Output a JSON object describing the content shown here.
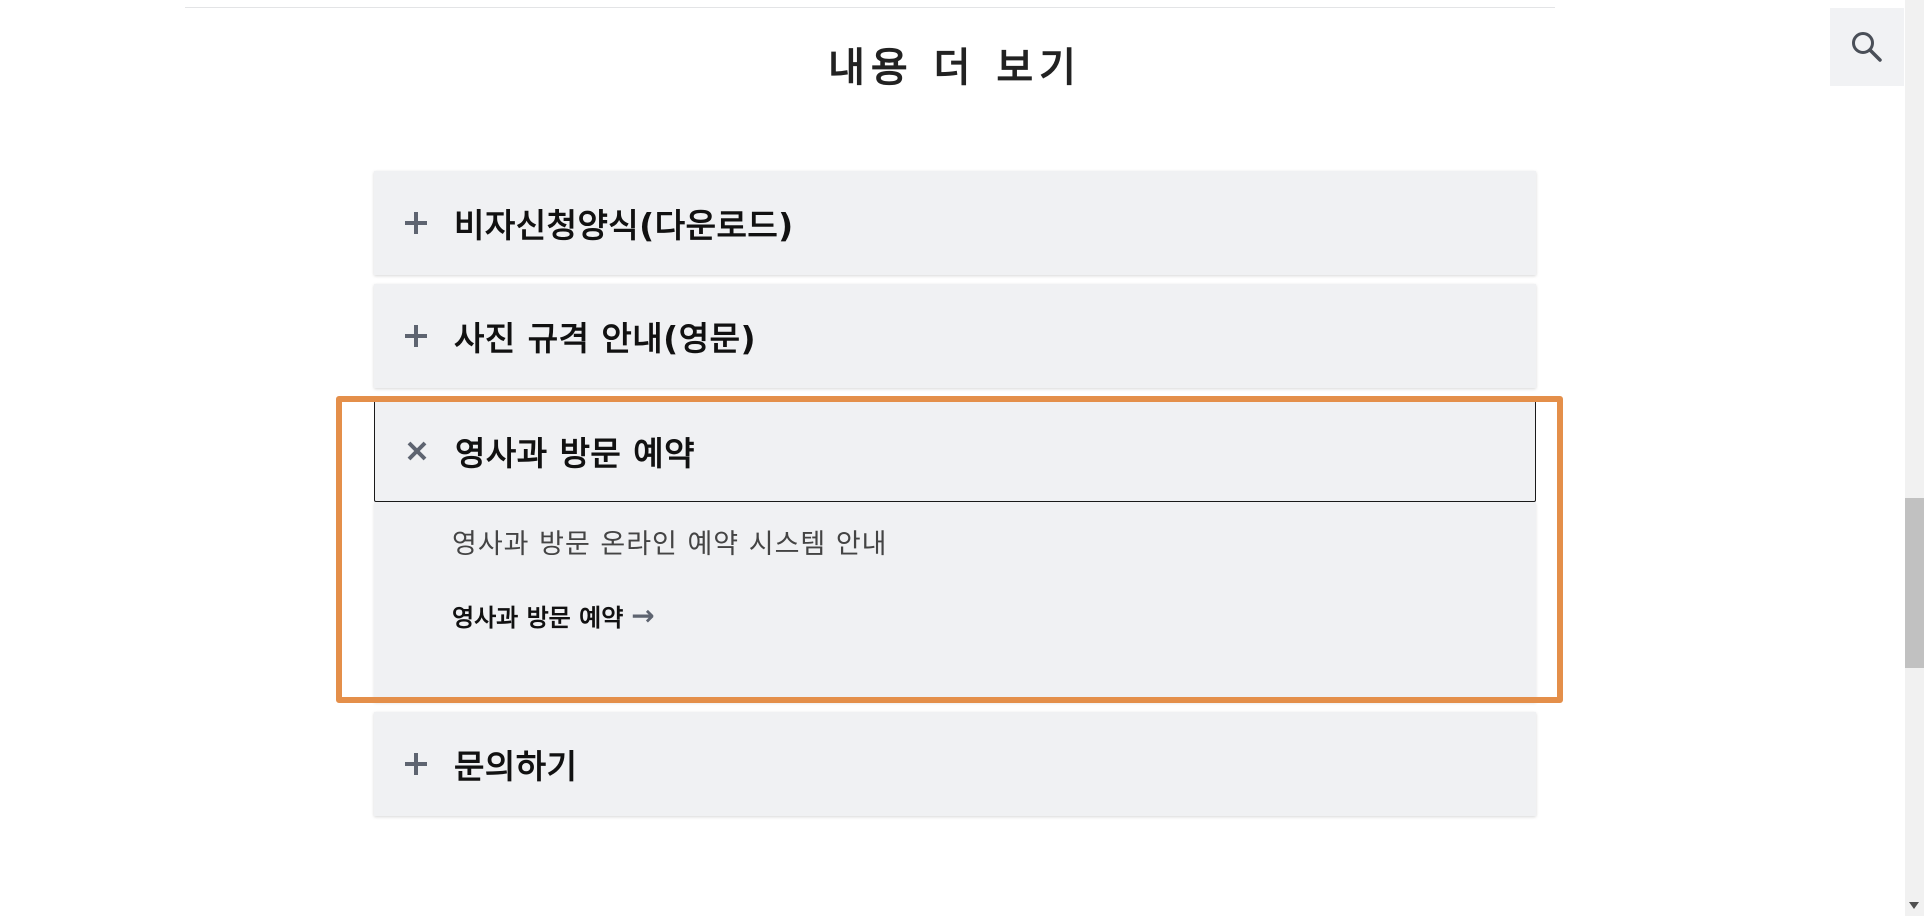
{
  "section": {
    "title": "내용 더 보기"
  },
  "search": {
    "icon": "search-icon"
  },
  "accordion": {
    "items": [
      {
        "label": "비자신청양식(다운로드)",
        "icon": "plus-icon",
        "expanded": false
      },
      {
        "label": "사진 규격 안내(영문)",
        "icon": "plus-icon",
        "expanded": false
      },
      {
        "label": "영사과 방문 예약",
        "icon": "close-icon",
        "expanded": true,
        "description": "영사과 방문 온라인 예약 시스템 안내",
        "link_label": "영사과 방문 예약",
        "link_arrow": "→"
      },
      {
        "label": "문의하기",
        "icon": "plus-icon",
        "expanded": false
      }
    ]
  },
  "colors": {
    "panel_bg": "#f0f1f3",
    "highlight": "#e48f4a",
    "icon": "#5e6470"
  }
}
